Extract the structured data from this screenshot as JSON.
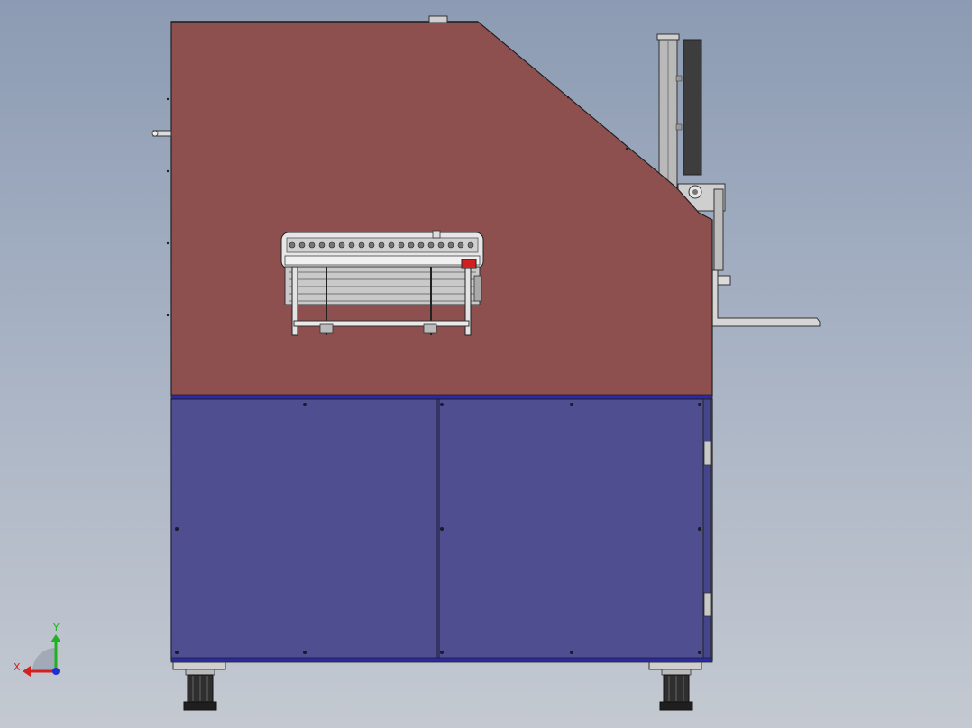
{
  "scene": {
    "background_top": "#8c9bb3",
    "background_bottom": "#c4c9d1",
    "upper_housing_color": "#8e4f4f",
    "lower_cabinet_color": "#4e4e90",
    "cabinet_trim_color": "#2a2aa8",
    "metal_color": "#c8c8c8",
    "dark_part_color": "#3a3a3a",
    "accent_red": "#d02020"
  },
  "triad": {
    "x_label": "X",
    "y_label": "Y",
    "x_color": "#d42020",
    "y_color": "#20b020",
    "z_color": "#2030d0",
    "icon": "coordinate-triad-icon"
  }
}
